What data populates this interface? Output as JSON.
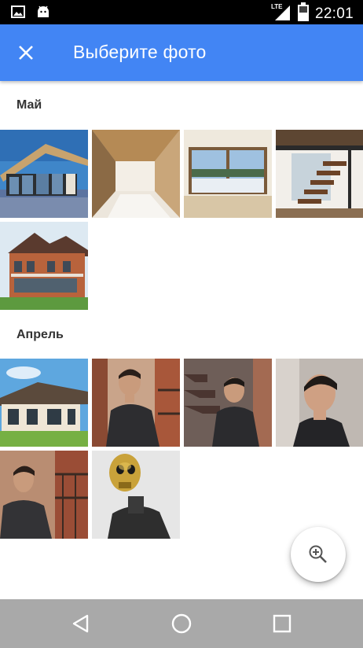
{
  "status_bar": {
    "time": "22:01",
    "network": "LTE",
    "icons": [
      "image-icon",
      "android-icon",
      "lte-signal-icon",
      "battery-icon"
    ]
  },
  "app_bar": {
    "title": "Выберите фото",
    "close_icon": "close-icon",
    "color": "#4285f4"
  },
  "sections": [
    {
      "label": "Май",
      "photos": [
        "modern-house-exterior",
        "wooden-interior-corridor",
        "panoramic-window-room",
        "loft-staircase-interior",
        "brick-cottage"
      ]
    },
    {
      "label": "Апрель",
      "photos": [
        "bungalow-house",
        "man-in-jacket-balcony",
        "man-on-stairs",
        "man-portrait",
        "man-near-railing",
        "golden-skull-statue"
      ]
    }
  ],
  "fab": {
    "icon": "zoom-in-icon"
  },
  "nav_bar": {
    "icons": [
      "back-icon",
      "home-icon",
      "recents-icon"
    ]
  }
}
